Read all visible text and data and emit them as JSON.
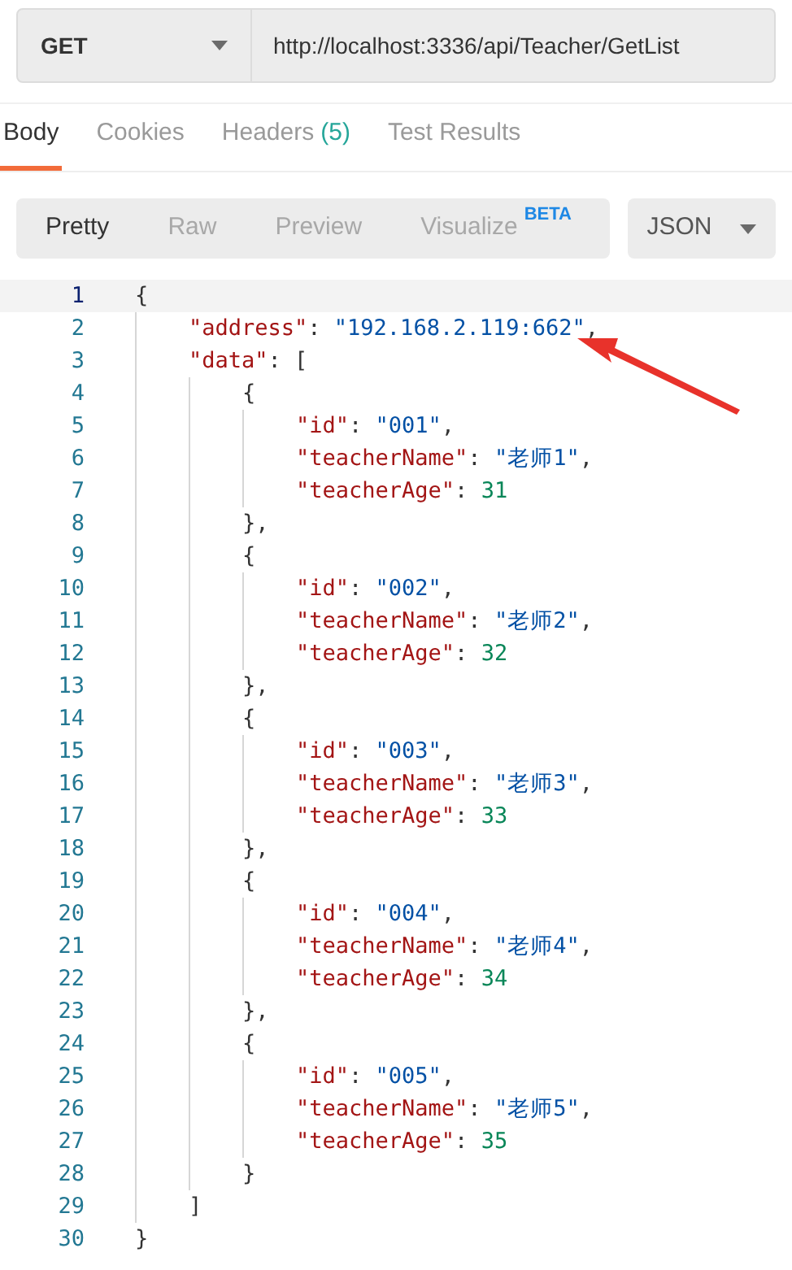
{
  "request": {
    "method": "GET",
    "url": "http://localhost:3336/api/Teacher/GetList"
  },
  "tabs": [
    {
      "label": "Body",
      "selected": true
    },
    {
      "label": "Cookies",
      "selected": false
    },
    {
      "label": "Headers",
      "count": "(5)",
      "selected": false
    },
    {
      "label": "Test Results",
      "selected": false
    }
  ],
  "view_modes": [
    {
      "label": "Pretty",
      "selected": true
    },
    {
      "label": "Raw",
      "selected": false
    },
    {
      "label": "Preview",
      "selected": false
    },
    {
      "label": "Visualize",
      "badge": "BETA",
      "selected": false
    }
  ],
  "format": "JSON",
  "lines": [
    {
      "number": "1",
      "current": true,
      "tokens": [
        {
          "kind": "punct",
          "text": "{"
        }
      ]
    },
    {
      "number": "2",
      "current": false,
      "tokens": [
        {
          "kind": "key",
          "text": "\"address\""
        },
        {
          "kind": "punct",
          "text": ": "
        },
        {
          "kind": "string",
          "text": "\"192.168.2.119:662\""
        },
        {
          "kind": "punct",
          "text": ","
        }
      ]
    },
    {
      "number": "3",
      "current": false,
      "tokens": [
        {
          "kind": "key",
          "text": "\"data\""
        },
        {
          "kind": "punct",
          "text": ": ["
        }
      ]
    },
    {
      "number": "4",
      "current": false,
      "tokens": [
        {
          "kind": "punct",
          "text": "{"
        }
      ]
    },
    {
      "number": "5",
      "current": false,
      "tokens": [
        {
          "kind": "key",
          "text": "\"id\""
        },
        {
          "kind": "punct",
          "text": ": "
        },
        {
          "kind": "string",
          "text": "\"001\""
        },
        {
          "kind": "punct",
          "text": ","
        }
      ]
    },
    {
      "number": "6",
      "current": false,
      "tokens": [
        {
          "kind": "key",
          "text": "\"teacherName\""
        },
        {
          "kind": "punct",
          "text": ": "
        },
        {
          "kind": "string",
          "text": "\"老师1\""
        },
        {
          "kind": "punct",
          "text": ","
        }
      ]
    },
    {
      "number": "7",
      "current": false,
      "tokens": [
        {
          "kind": "key",
          "text": "\"teacherAge\""
        },
        {
          "kind": "punct",
          "text": ": "
        },
        {
          "kind": "number",
          "text": "31"
        }
      ]
    },
    {
      "number": "8",
      "current": false,
      "tokens": [
        {
          "kind": "punct",
          "text": "},"
        }
      ]
    },
    {
      "number": "9",
      "current": false,
      "tokens": [
        {
          "kind": "punct",
          "text": "{"
        }
      ]
    },
    {
      "number": "10",
      "current": false,
      "tokens": [
        {
          "kind": "key",
          "text": "\"id\""
        },
        {
          "kind": "punct",
          "text": ": "
        },
        {
          "kind": "string",
          "text": "\"002\""
        },
        {
          "kind": "punct",
          "text": ","
        }
      ]
    },
    {
      "number": "11",
      "current": false,
      "tokens": [
        {
          "kind": "key",
          "text": "\"teacherName\""
        },
        {
          "kind": "punct",
          "text": ": "
        },
        {
          "kind": "string",
          "text": "\"老师2\""
        },
        {
          "kind": "punct",
          "text": ","
        }
      ]
    },
    {
      "number": "12",
      "current": false,
      "tokens": [
        {
          "kind": "key",
          "text": "\"teacherAge\""
        },
        {
          "kind": "punct",
          "text": ": "
        },
        {
          "kind": "number",
          "text": "32"
        }
      ]
    },
    {
      "number": "13",
      "current": false,
      "tokens": [
        {
          "kind": "punct",
          "text": "},"
        }
      ]
    },
    {
      "number": "14",
      "current": false,
      "tokens": [
        {
          "kind": "punct",
          "text": "{"
        }
      ]
    },
    {
      "number": "15",
      "current": false,
      "tokens": [
        {
          "kind": "key",
          "text": "\"id\""
        },
        {
          "kind": "punct",
          "text": ": "
        },
        {
          "kind": "string",
          "text": "\"003\""
        },
        {
          "kind": "punct",
          "text": ","
        }
      ]
    },
    {
      "number": "16",
      "current": false,
      "tokens": [
        {
          "kind": "key",
          "text": "\"teacherName\""
        },
        {
          "kind": "punct",
          "text": ": "
        },
        {
          "kind": "string",
          "text": "\"老师3\""
        },
        {
          "kind": "punct",
          "text": ","
        }
      ]
    },
    {
      "number": "17",
      "current": false,
      "tokens": [
        {
          "kind": "key",
          "text": "\"teacherAge\""
        },
        {
          "kind": "punct",
          "text": ": "
        },
        {
          "kind": "number",
          "text": "33"
        }
      ]
    },
    {
      "number": "18",
      "current": false,
      "tokens": [
        {
          "kind": "punct",
          "text": "},"
        }
      ]
    },
    {
      "number": "19",
      "current": false,
      "tokens": [
        {
          "kind": "punct",
          "text": "{"
        }
      ]
    },
    {
      "number": "20",
      "current": false,
      "tokens": [
        {
          "kind": "key",
          "text": "\"id\""
        },
        {
          "kind": "punct",
          "text": ": "
        },
        {
          "kind": "string",
          "text": "\"004\""
        },
        {
          "kind": "punct",
          "text": ","
        }
      ]
    },
    {
      "number": "21",
      "current": false,
      "tokens": [
        {
          "kind": "key",
          "text": "\"teacherName\""
        },
        {
          "kind": "punct",
          "text": ": "
        },
        {
          "kind": "string",
          "text": "\"老师4\""
        },
        {
          "kind": "punct",
          "text": ","
        }
      ]
    },
    {
      "number": "22",
      "current": false,
      "tokens": [
        {
          "kind": "key",
          "text": "\"teacherAge\""
        },
        {
          "kind": "punct",
          "text": ": "
        },
        {
          "kind": "number",
          "text": "34"
        }
      ]
    },
    {
      "number": "23",
      "current": false,
      "tokens": [
        {
          "kind": "punct",
          "text": "},"
        }
      ]
    },
    {
      "number": "24",
      "current": false,
      "tokens": [
        {
          "kind": "punct",
          "text": "{"
        }
      ]
    },
    {
      "number": "25",
      "current": false,
      "tokens": [
        {
          "kind": "key",
          "text": "\"id\""
        },
        {
          "kind": "punct",
          "text": ": "
        },
        {
          "kind": "string",
          "text": "\"005\""
        },
        {
          "kind": "punct",
          "text": ","
        }
      ]
    },
    {
      "number": "26",
      "current": false,
      "tokens": [
        {
          "kind": "key",
          "text": "\"teacherName\""
        },
        {
          "kind": "punct",
          "text": ": "
        },
        {
          "kind": "string",
          "text": "\"老师5\""
        },
        {
          "kind": "punct",
          "text": ","
        }
      ]
    },
    {
      "number": "27",
      "current": false,
      "tokens": [
        {
          "kind": "key",
          "text": "\"teacherAge\""
        },
        {
          "kind": "punct",
          "text": ": "
        },
        {
          "kind": "number",
          "text": "35"
        }
      ]
    },
    {
      "number": "28",
      "current": false,
      "tokens": [
        {
          "kind": "punct",
          "text": "}"
        }
      ]
    },
    {
      "number": "29",
      "current": false,
      "tokens": [
        {
          "kind": "punct",
          "text": "]"
        }
      ]
    },
    {
      "number": "30",
      "current": false,
      "tokens": [
        {
          "kind": "punct",
          "text": "}"
        }
      ]
    }
  ]
}
